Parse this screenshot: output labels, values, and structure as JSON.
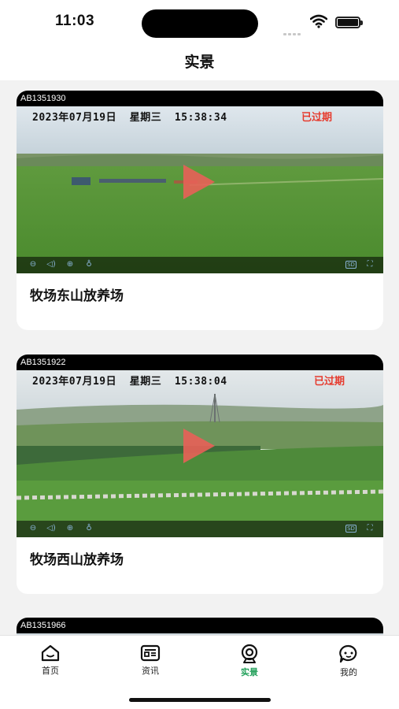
{
  "status_bar": {
    "time": "11:03"
  },
  "header": {
    "title": "实景"
  },
  "cards": [
    {
      "device_id": "AB1351930",
      "datetime": "2023年07月19日  星期三  15:38:34",
      "status": "已过期",
      "title": "牧场东山放养场"
    },
    {
      "device_id": "AB1351922",
      "datetime": "2023年07月19日  星期三  15:38:04",
      "status": "已过期",
      "title": "牧场西山放养场"
    },
    {
      "device_id": "AB1351966"
    }
  ],
  "controls": {
    "left_icons": [
      "pause-icon",
      "volume-icon",
      "ptz-icon",
      "mic-icon"
    ],
    "right_icons": [
      "sd-icon",
      "fullscreen-icon"
    ],
    "sd_label": "SD"
  },
  "tab_bar": {
    "tabs": [
      {
        "label": "首页",
        "icon": "home-icon"
      },
      {
        "label": "资讯",
        "icon": "news-icon"
      },
      {
        "label": "实景",
        "icon": "camera-icon",
        "active": true
      },
      {
        "label": "我的",
        "icon": "chat-icon"
      }
    ]
  },
  "colors": {
    "active_tab": "#22a05a",
    "expired": "#e63b2e",
    "play": "#e86058"
  }
}
